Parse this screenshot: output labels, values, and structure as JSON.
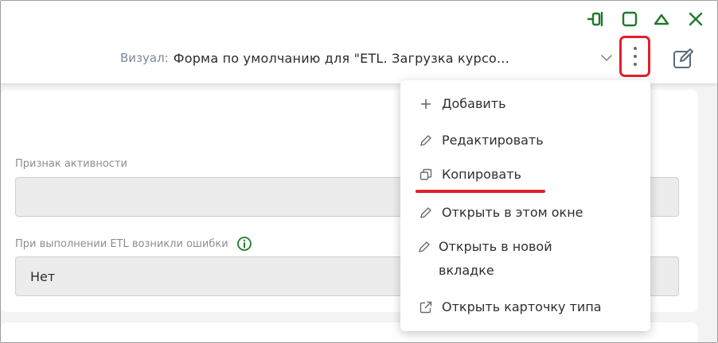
{
  "window_controls": [
    {
      "name": "pin-icon"
    },
    {
      "name": "maximize-icon"
    },
    {
      "name": "collapse-icon"
    },
    {
      "name": "close-icon"
    }
  ],
  "visual": {
    "label": "Визуал:",
    "value": "Форма по умолчанию для \"ETL. Загрузка курсо…"
  },
  "fields": {
    "active": {
      "label": "Признак активности",
      "value": ""
    },
    "etl_errors": {
      "label": "При выполнении ETL возникли ошибки",
      "value": "Нет"
    }
  },
  "menu": {
    "items": [
      {
        "label": "Добавить",
        "icon": "plus-icon"
      },
      {
        "label": "Редактировать",
        "icon": "pencil-icon"
      },
      {
        "label": "Копировать",
        "icon": "copy-icon"
      },
      {
        "label": "Открыть в этом окне",
        "icon": "pencil-icon"
      },
      {
        "label": "Открыть в новой вкладке",
        "icon": "pencil-icon"
      },
      {
        "label": "Открыть карточку типа",
        "icon": "external-link-icon"
      }
    ]
  },
  "colors": {
    "accent_green": "#1f7a2e",
    "highlight_red": "#e0202a",
    "label_gray": "#7b8a9c"
  }
}
